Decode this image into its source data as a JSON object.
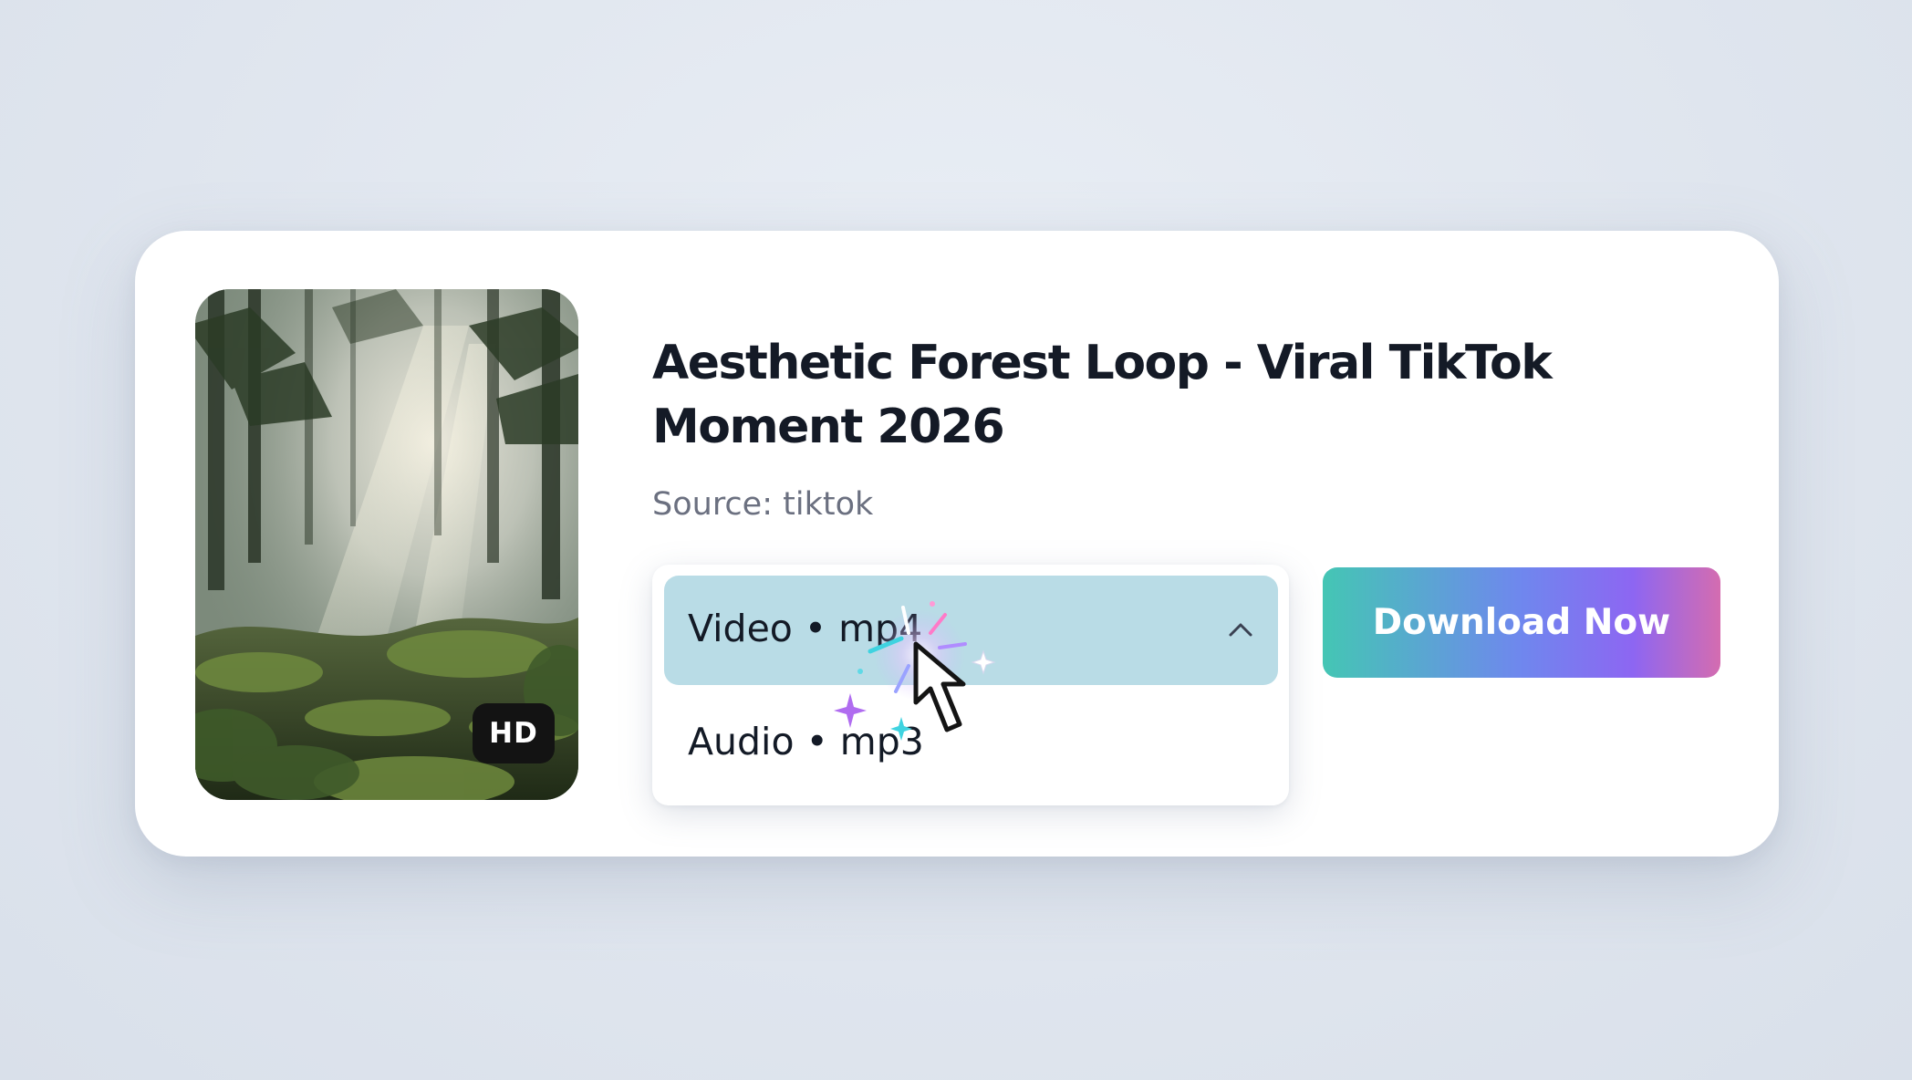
{
  "video": {
    "title": "Aesthetic Forest Loop -  Viral TikTok Moment 2026",
    "source": "Source: tiktok",
    "quality_badge": "HD"
  },
  "format_dropdown": {
    "expanded": true,
    "selected": "Video • mp4",
    "options": [
      "Video • mp4",
      "Audio • mp3"
    ]
  },
  "actions": {
    "download_label": "Download Now"
  },
  "icons": {
    "chevron": "chevron-up-icon",
    "pointer": "pointer-cursor-icon",
    "sparkle": "sparkle-icon"
  },
  "colors": {
    "selected_option_bg": "#b9dce6",
    "button_gradient": [
      "#44c6b4",
      "#6f87ee",
      "#8d66f2",
      "#d46cb0"
    ]
  }
}
